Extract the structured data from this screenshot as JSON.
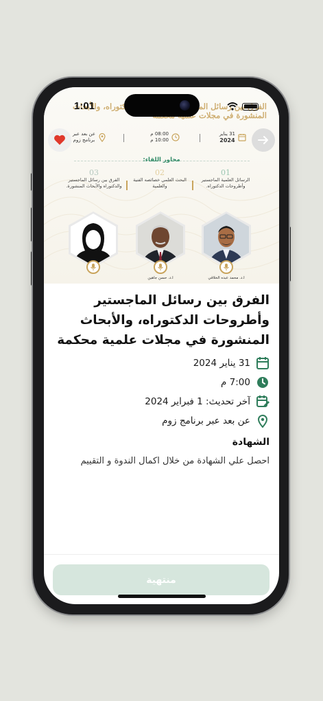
{
  "status_bar": {
    "time": "1:01"
  },
  "banner": {
    "title_line1": "الفرق بين رسائل الماجستير وأطروحات الدكتوراه، والأبحاث",
    "title_line2": "المنشورة في مجلات علمية محكمة",
    "date_day": "31 يناير",
    "date_year": "2024",
    "time_from": "08:00 م",
    "time_to": "10:00 م",
    "location_line1": "عن بعد عبر",
    "location_line2": "برنامج زوم",
    "axes_title": "محاور اللقاء:",
    "axes": [
      {
        "num": "01",
        "text": "الرسائل العلمية الماجستير وأطروحات الدكتوراه."
      },
      {
        "num": "02",
        "text": "البحث العلمي خصائصه الفنية والعلمية"
      },
      {
        "num": "03",
        "text": "الفرق بين رسائل الماجستير والدكتوراه والأبحاث المنشورة."
      }
    ],
    "speakers": [
      {
        "name": "أ.د. محمد عبده الخلاقي"
      },
      {
        "name": "أ.د. حسن جاهين"
      },
      {
        "name": ""
      }
    ]
  },
  "event": {
    "title": "الفرق بين رسائل الماجستير وأطروحات الدكتوراه، والأبحاث المنشورة في مجلات علمية محكمة",
    "date": "31 يناير 2024",
    "time": "7:00 م",
    "last_update": "آخر تحديث: 1 فبراير 2024",
    "location": "عن بعد عبر برنامج زوم",
    "certificate_title": "الشهادة",
    "certificate_text": "احصل علي الشهادة من خلال اكمال الندوة و التقييم"
  },
  "footer": {
    "ended_label": "منتهية"
  },
  "colors": {
    "accent_green": "#2f7d5b",
    "gold": "#c9a45c",
    "button_disabled": "#d6e6dd",
    "favorite_red": "#e0382b"
  }
}
